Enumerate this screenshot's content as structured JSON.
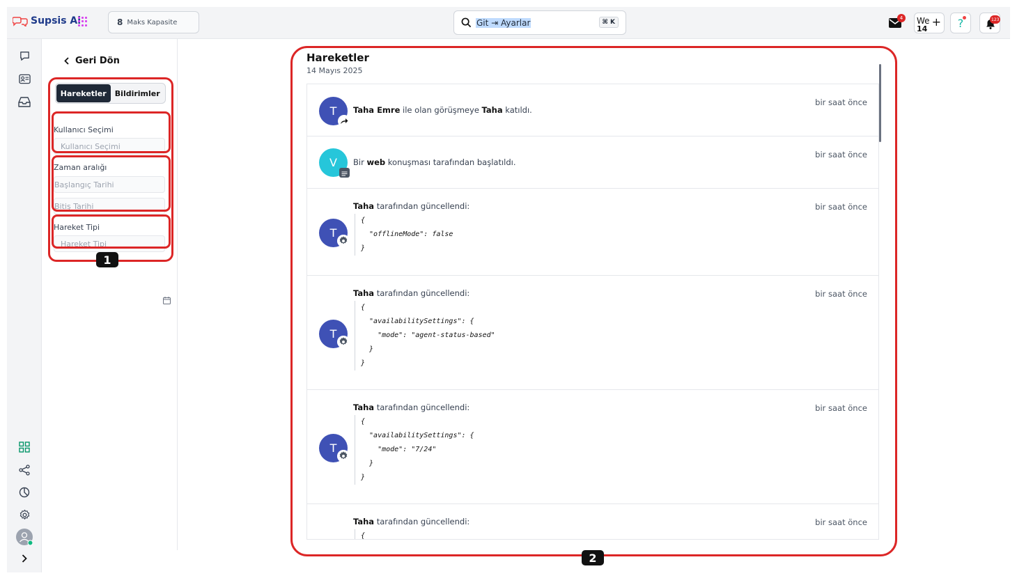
{
  "app": {
    "name": "Supsis Ai",
    "brand_color": "#1e3a8a"
  },
  "topbar": {
    "capacity_number": "8",
    "capacity_label": "Maks Kapasite",
    "search_text": "Git ⇥ Ayarlar",
    "search_shortcut": "⌘ K",
    "mail_badge": "4",
    "workspace_label": "We",
    "workspace_count": "14",
    "help_label": "?",
    "notification_badge": "123"
  },
  "panel": {
    "back_label": "Geri Dön",
    "tabs": [
      {
        "label": "Hareketler",
        "active": true
      },
      {
        "label": "Bildirimler",
        "active": false
      }
    ],
    "user_label": "Kullanıcı Seçimi",
    "user_placeholder": "Kullanıcı Seçimi",
    "range_label": "Zaman aralığı",
    "start_placeholder": "Başlangıç Tarihi",
    "end_placeholder": "Bitiş Tarihi",
    "type_label": "Hareket Tipi",
    "type_placeholder": "Hareket Tipi"
  },
  "annotations": {
    "one": "1",
    "two": "2"
  },
  "main": {
    "title": "Hareketler",
    "date": "14 Mayıs 2025",
    "items": [
      {
        "avatar": "T",
        "time": "bir saat önce",
        "b1": "Taha Emre",
        "t1": " ile olan görüşmeye ",
        "b2": "Taha",
        "t2": " katıldı."
      },
      {
        "avatar": "V",
        "time": "bir saat önce",
        "t0": "Bir ",
        "b1": "web",
        "t1": " konuşması tarafından başlatıldı."
      },
      {
        "avatar": "T",
        "time": "bir saat önce",
        "b1": "Taha",
        "t1": " tarafından güncellendi:",
        "code": "{\n  \"offlineMode\": false\n}"
      },
      {
        "avatar": "T",
        "time": "bir saat önce",
        "b1": "Taha",
        "t1": " tarafından güncellendi:",
        "code": "{\n  \"availabilitySettings\": {\n    \"mode\": \"agent-status-based\"\n  }\n}"
      },
      {
        "avatar": "T",
        "time": "bir saat önce",
        "b1": "Taha",
        "t1": " tarafından güncellendi:",
        "code": "{\n  \"availabilitySettings\": {\n    \"mode\": \"7/24\"\n  }\n}"
      },
      {
        "avatar": "T",
        "time": "bir saat önce",
        "b1": "Taha",
        "t1": " tarafından güncellendi:",
        "code": "{"
      }
    ]
  }
}
